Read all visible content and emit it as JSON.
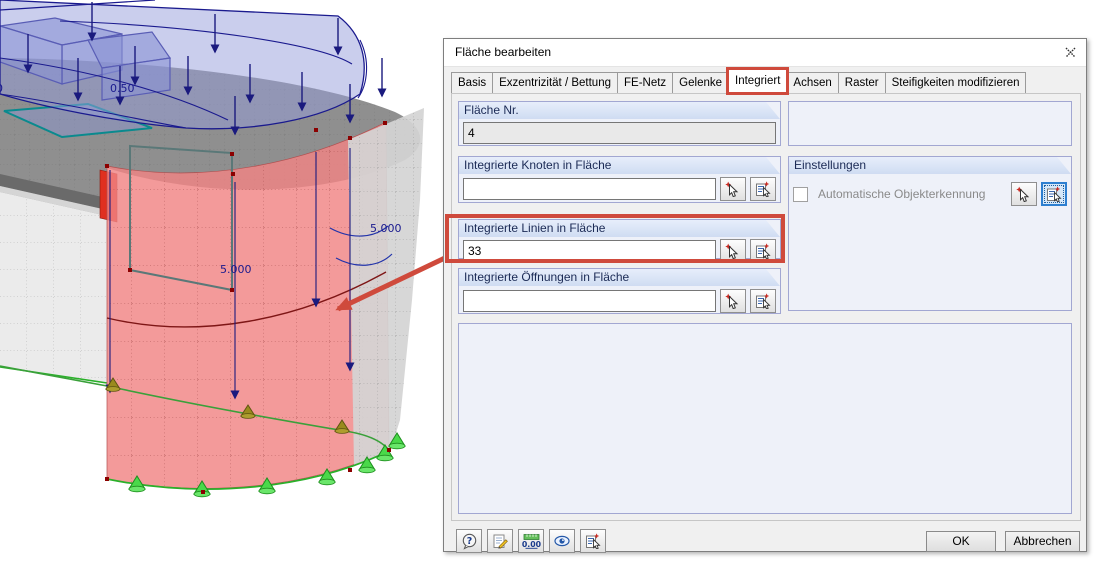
{
  "window": {
    "title": "Fläche bearbeiten"
  },
  "tabs": [
    {
      "label": "Basis",
      "active": false
    },
    {
      "label": "Exzentrizität / Bettung",
      "active": false
    },
    {
      "label": "FE-Netz",
      "active": false
    },
    {
      "label": "Gelenke",
      "active": false
    },
    {
      "label": "Integriert",
      "active": true
    },
    {
      "label": "Achsen",
      "active": false
    },
    {
      "label": "Raster",
      "active": false
    },
    {
      "label": "Steifigkeiten modifizieren",
      "active": false
    }
  ],
  "fields": {
    "flaeche_nr": {
      "label": "Fläche Nr.",
      "value": "4",
      "readonly": true
    },
    "knoten": {
      "label": "Integrierte Knoten in Fläche",
      "value": ""
    },
    "linien": {
      "label": "Integrierte Linien in Fläche",
      "value": "33",
      "highlighted": true
    },
    "oeffnungen": {
      "label": "Integrierte Öffnungen in Fläche",
      "value": ""
    }
  },
  "einstellungen": {
    "label": "Einstellungen",
    "checkbox_label": "Automatische Objekterkennung",
    "checked": false,
    "active_button": "pick-list"
  },
  "footer": {
    "ok": "OK",
    "cancel": "Abbrechen"
  },
  "icons": [
    "help-icon",
    "comment-edit-icon",
    "units-icon",
    "display-properties-icon",
    "pick-list-icon",
    "pick-icon",
    "close-icon"
  ],
  "viewport_labels": {
    "top_left_cut": "0",
    "top_offset": "0.50",
    "height_mid": "5.000",
    "height_right": "5.000"
  },
  "annotation": {
    "color": "#cf4a3c",
    "highlighted_tab": "Integriert",
    "highlighted_field": "Integrierte Linien in Fläche"
  }
}
